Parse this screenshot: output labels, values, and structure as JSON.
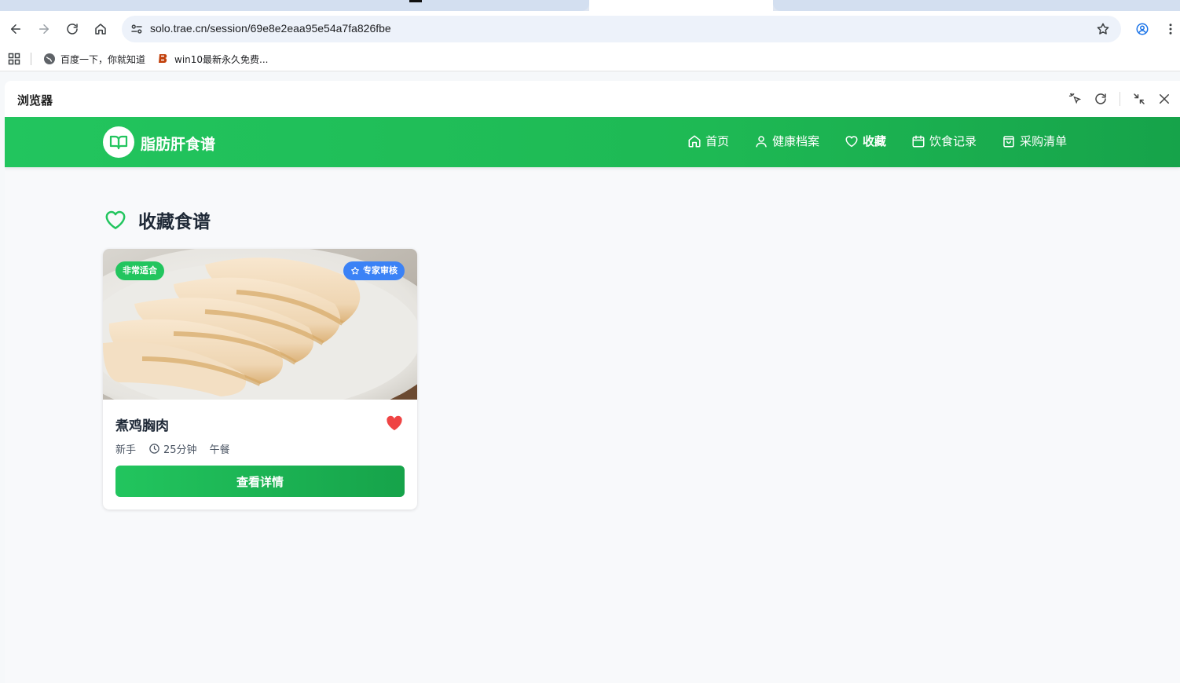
{
  "browser": {
    "url": "solo.trae.cn/session/69e8e2eaa95e54a7fa826fbe",
    "bookmarks": [
      {
        "label": "百度一下，你就知道",
        "icon": "globe-icon"
      },
      {
        "label": "win10最新永久免费...",
        "icon": "b-logo-icon"
      }
    ]
  },
  "panel": {
    "title": "浏览器"
  },
  "app": {
    "logo_text": "脂肪肝食谱",
    "nav": [
      {
        "label": "首页",
        "icon": "home-icon"
      },
      {
        "label": "健康档案",
        "icon": "user-icon"
      },
      {
        "label": "收藏",
        "icon": "heart-icon",
        "active": true
      },
      {
        "label": "饮食记录",
        "icon": "calendar-icon"
      },
      {
        "label": "采购清单",
        "icon": "shopping-bag-icon"
      }
    ],
    "page_title": "收藏食谱",
    "recipe": {
      "suitability_badge": "非常适合",
      "expert_badge": "专家审核",
      "name": "煮鸡胸肉",
      "difficulty": "新手",
      "duration": "25分钟",
      "meal": "午餐",
      "detail_button": "查看详情"
    }
  },
  "colors": {
    "brand_green": "#22c55e",
    "expert_blue": "#3b82f6",
    "favorite_red": "#ef4444"
  }
}
